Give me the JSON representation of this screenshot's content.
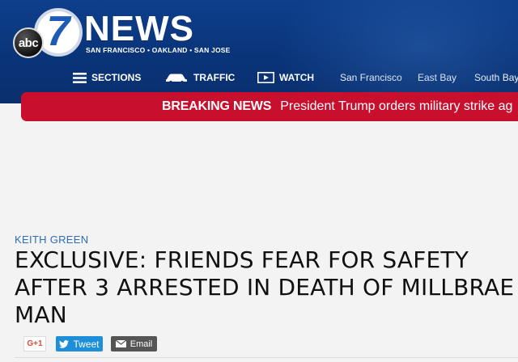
{
  "logo": {
    "abc_text": "abc",
    "seven_text": "7",
    "news_text": "NEWS",
    "tagline": "SAN FRANCISCO • OAKLAND • SAN JOSE"
  },
  "nav": {
    "sections_label": "SECTIONS",
    "traffic_label": "TRAFFIC",
    "watch_label": "WATCH",
    "links": [
      "San Francisco",
      "East Bay",
      "South Bay"
    ]
  },
  "breaking": {
    "label": "BREAKING NEWS",
    "text": "President Trump orders military strike ag"
  },
  "article": {
    "byline": "KEITH GREEN",
    "headline": "EXCLUSIVE: FRIENDS FEAR FOR SAFETY AFTER 3 ARRESTED IN DEATH OF MILLBRAE MAN"
  },
  "share": {
    "gplus_label": "G+1",
    "tweet_label": "Tweet",
    "email_label": "Email"
  },
  "colors": {
    "header_blue": "#0a3479",
    "breaking_red": "#c8102e",
    "byline_blue": "#2e6db8",
    "twitter_blue": "#1d8fd8"
  }
}
